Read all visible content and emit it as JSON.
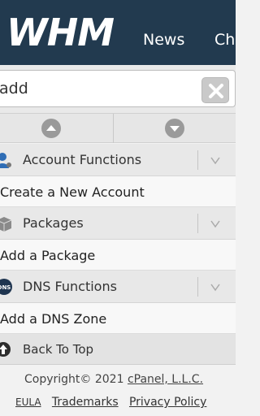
{
  "header": {
    "logo_text": "WHM",
    "nav": [
      "News",
      "Ch"
    ]
  },
  "search": {
    "value": "add",
    "placeholder": "Search Features"
  },
  "sections": [
    {
      "label": "Account Functions",
      "icon": "account-functions-icon",
      "items": [
        "Create a New Account"
      ]
    },
    {
      "label": "Packages",
      "icon": "packages-icon",
      "items": [
        "Add a Package"
      ]
    },
    {
      "label": "DNS Functions",
      "icon": "dns-functions-icon",
      "icon_text": "DNS",
      "items": [
        "Add a DNS Zone"
      ]
    }
  ],
  "back_to_top": "Back To Top",
  "footer": {
    "copyright_prefix": "Copyright© 2021 ",
    "brand": "cPanel, L.L.C.",
    "links": [
      "EULA",
      "Trademarks",
      "Privacy Policy"
    ]
  },
  "colors": {
    "header_bg": "#223a4f",
    "accent_blue": "#2f6db5"
  }
}
